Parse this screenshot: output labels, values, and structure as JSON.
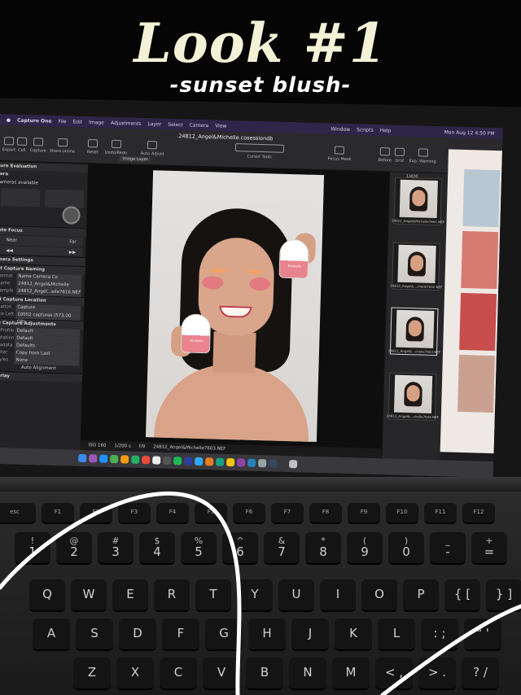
{
  "overlay": {
    "title": "Look #1",
    "subtitle": "-sunset blush-"
  },
  "menubar": {
    "items": [
      "Capture One",
      "File",
      "Edit",
      "Image",
      "Adjustments",
      "Layer",
      "Select",
      "Camera",
      "View"
    ],
    "extra_items": [
      "Window",
      "Scripts",
      "Help"
    ],
    "clock": "Mon Aug 12 4:50 PM"
  },
  "toolbar": {
    "document_title": "24812_Angel&Michelle.cosessiondb",
    "left_tools": [
      "Export",
      "Cull",
      "Capture",
      "Share online"
    ],
    "tools": [
      "Reset",
      "Undo/Redo",
      "Auto Adjust"
    ],
    "cursor_tools_label": "Cursor Tools",
    "focus_mask_label": "Focus Mask",
    "right_tools": [
      "Before",
      "Grid",
      "Exp. Warning"
    ],
    "layer_select": "Image Layer"
  },
  "left_panel": {
    "capture_evaluation": "ure Evaluation",
    "camera_header": "era",
    "camera_status": "ameras available",
    "remote_focus": "ote Focus",
    "focus_near": "Near",
    "focus_far": "Far",
    "camera_settings": "mera Settings",
    "next_capture_naming": "xt Capture Naming",
    "naming_rows": [
      {
        "key": "Format",
        "value": "Name   Camera Co"
      },
      {
        "key": "Name",
        "value": "24812_Angel&Michelle"
      },
      {
        "key": "Sample",
        "value": "24812_Angel...elle7616.NEF"
      }
    ],
    "next_capture_location": "xt Capture Location",
    "location_rows": [
      {
        "key": "ination",
        "value": "Capture"
      },
      {
        "key": "ace Left",
        "value": "10552 captures (573.00 GB)"
      }
    ],
    "next_capture_adjustments": "xt Capture Adjustments",
    "adjustment_rows": [
      {
        "key": "C Profile",
        "value": "Default"
      },
      {
        "key": "entation",
        "value": "Default"
      },
      {
        "key": "etadata",
        "value": "Defaults"
      },
      {
        "key": "Other",
        "value": "Copy from Last"
      },
      {
        "key": "Styles",
        "value": "None"
      }
    ],
    "auto_alignment": "Auto Alignment",
    "overlay_header": "verlay"
  },
  "viewer": {
    "product_brand": "Mirabelle",
    "status": {
      "iso": "ISO 160",
      "shutter": "1/200 s",
      "aperture": "f/9",
      "filename": "24812_Angel&Michelle7603.NEF"
    }
  },
  "filmstrip": {
    "counter": "1/420",
    "thumbs": [
      {
        "name": "24812_Angel&Michelle7601.NEF"
      },
      {
        "name": "24812_Angel&...chelle7602.NEF"
      },
      {
        "name": "24812_Angel&...chelle7603.NEF"
      },
      {
        "name": "24812_Angel&...chelle7604.NEF"
      }
    ]
  },
  "keyboard": {
    "fn_row": [
      "esc",
      "F1",
      "F2",
      "F3",
      "F4",
      "F5",
      "F6",
      "F7",
      "F8",
      "F9",
      "F10",
      "F11",
      "F12"
    ],
    "number_row": [
      {
        "top": "!",
        "bottom": "1"
      },
      {
        "top": "@",
        "bottom": "2"
      },
      {
        "top": "#",
        "bottom": "3"
      },
      {
        "top": "$",
        "bottom": "4"
      },
      {
        "top": "%",
        "bottom": "5"
      },
      {
        "top": "^",
        "bottom": "6"
      },
      {
        "top": "&",
        "bottom": "7"
      },
      {
        "top": "*",
        "bottom": "8"
      },
      {
        "top": "(",
        "bottom": "9"
      },
      {
        "top": ")",
        "bottom": "0"
      },
      {
        "top": "_",
        "bottom": "-"
      },
      {
        "top": "+",
        "bottom": "="
      }
    ],
    "top_row": [
      "Q",
      "W",
      "E",
      "R",
      "T",
      "Y",
      "U",
      "I",
      "O",
      "P",
      "{ [",
      "} ]"
    ],
    "home_row": [
      "A",
      "S",
      "D",
      "F",
      "G",
      "H",
      "J",
      "K",
      "L",
      ": ;",
      "\" '"
    ],
    "bottom_row": [
      "Z",
      "X",
      "C",
      "V",
      "B",
      "N",
      "M",
      "< ,",
      "> .",
      "? /"
    ]
  }
}
